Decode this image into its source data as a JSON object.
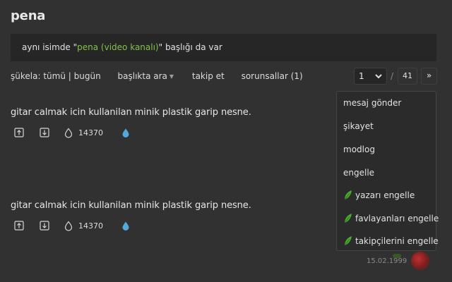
{
  "page": {
    "title": "pena"
  },
  "notice": {
    "prefix": "aynı isimde \"",
    "link": "pena (video kanalı)",
    "suffix": "\" başlığı da var"
  },
  "toolbar": {
    "sukela": "şükela:",
    "tumu": "tümü",
    "sep": "|",
    "bugun": "bugün",
    "search_label": "başlıkta ara",
    "follow_label": "takip et",
    "sorunsal_label": "sorunsallar (1)"
  },
  "pager": {
    "current": "1",
    "separator": "/",
    "total": "41",
    "next": "»"
  },
  "entries": [
    {
      "text": "gitar calmak icin kullanilan minik plastik garip nesne.",
      "fav_count": "14370"
    },
    {
      "text": "gitar calmak icin kullanilan minik plastik garip nesne.",
      "fav_count": "14370"
    }
  ],
  "menu": {
    "items": [
      {
        "label": "mesaj gönder",
        "icon": ""
      },
      {
        "label": "şikayet",
        "icon": ""
      },
      {
        "label": "modlog",
        "icon": ""
      },
      {
        "label": "engelle",
        "icon": ""
      },
      {
        "label": "yazarı engelle",
        "icon": "leaf-icon"
      },
      {
        "label": "favlayanları engelle",
        "icon": "leaf-icon"
      },
      {
        "label": "takipçilerini engelle",
        "icon": "leaf-icon"
      }
    ]
  },
  "author": {
    "date": "15.02.1999"
  },
  "colors": {
    "background": "#313131",
    "link_green": "#81c14b",
    "drop_blue": "#53a8d8",
    "leaf_green": "#4caf2f"
  }
}
